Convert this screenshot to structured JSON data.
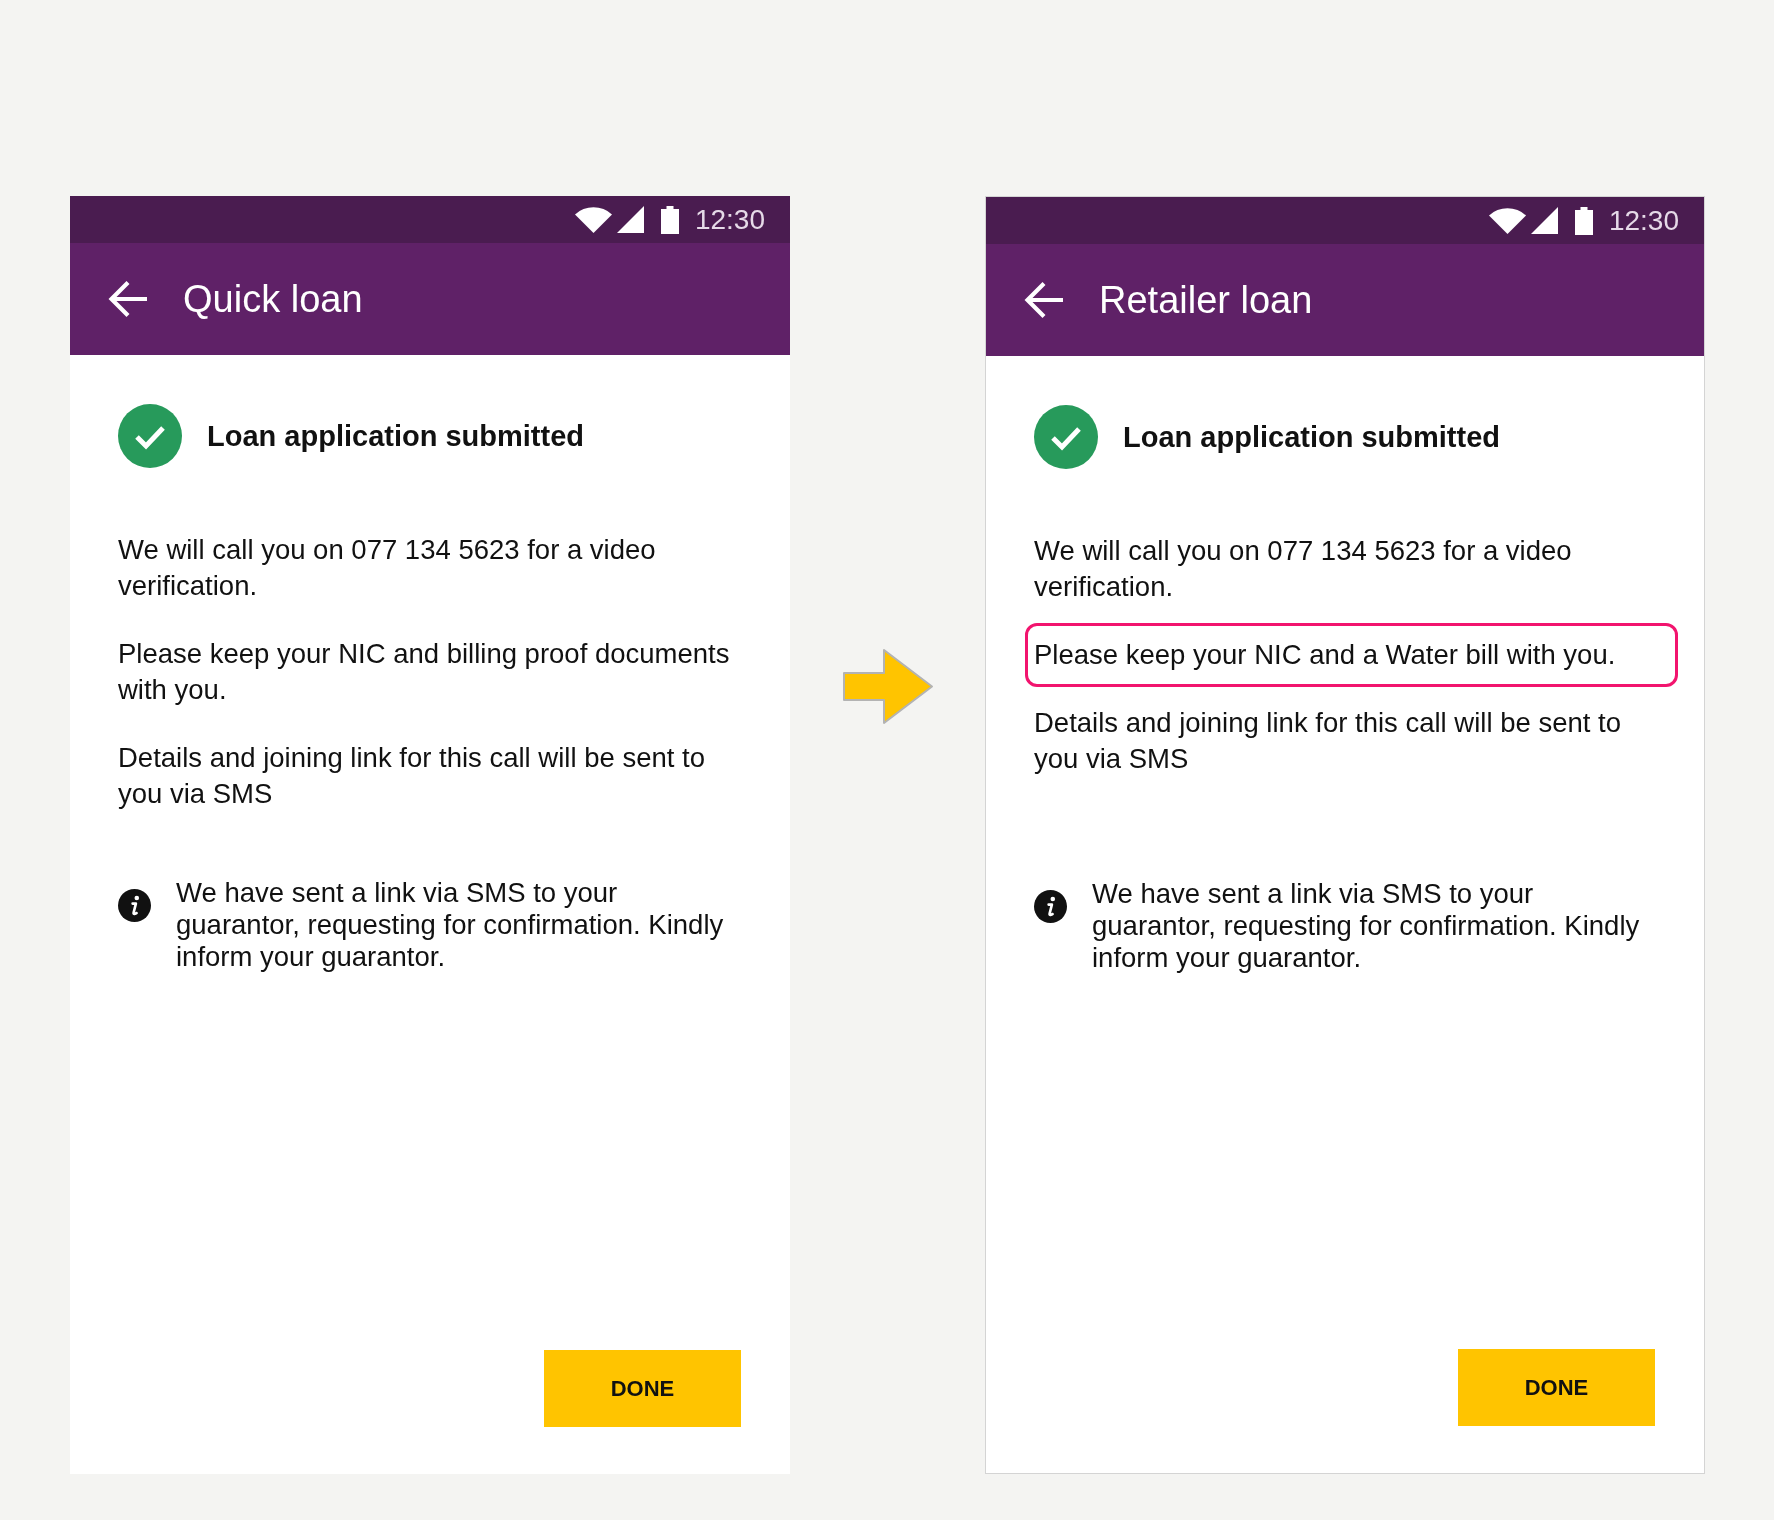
{
  "screens": [
    {
      "framed": false,
      "status_bar": {
        "time": "12:30"
      },
      "app_bar": {
        "title": "Quick loan"
      },
      "heading": "Loan application submitted",
      "paragraphs": [
        {
          "text": "We will call you on 077 134 5623 for a video verification.",
          "highlighted": false
        },
        {
          "text": "Please keep your NIC and billing proof documents with you.",
          "highlighted": false
        },
        {
          "text": "Details and joining link for this call will be sent to you via SMS",
          "highlighted": false
        }
      ],
      "info_note": "We have sent a link via SMS to your guarantor, requesting for confirmation. Kindly inform your guarantor.",
      "button": "DONE"
    },
    {
      "framed": true,
      "status_bar": {
        "time": "12:30"
      },
      "app_bar": {
        "title": "Retailer loan"
      },
      "heading": "Loan application submitted",
      "paragraphs": [
        {
          "text": "We will call you on 077 134 5623 for a video verification.",
          "highlighted": false
        },
        {
          "text": "Please keep your NIC and a Water bill with you.",
          "highlighted": true
        },
        {
          "text": "Details and joining link for this call will be sent to you via SMS",
          "highlighted": false
        }
      ],
      "info_note": "We have sent a link via SMS to your guarantor, requesting for confirmation. Kindly inform your guarantor.",
      "button": "DONE"
    }
  ]
}
